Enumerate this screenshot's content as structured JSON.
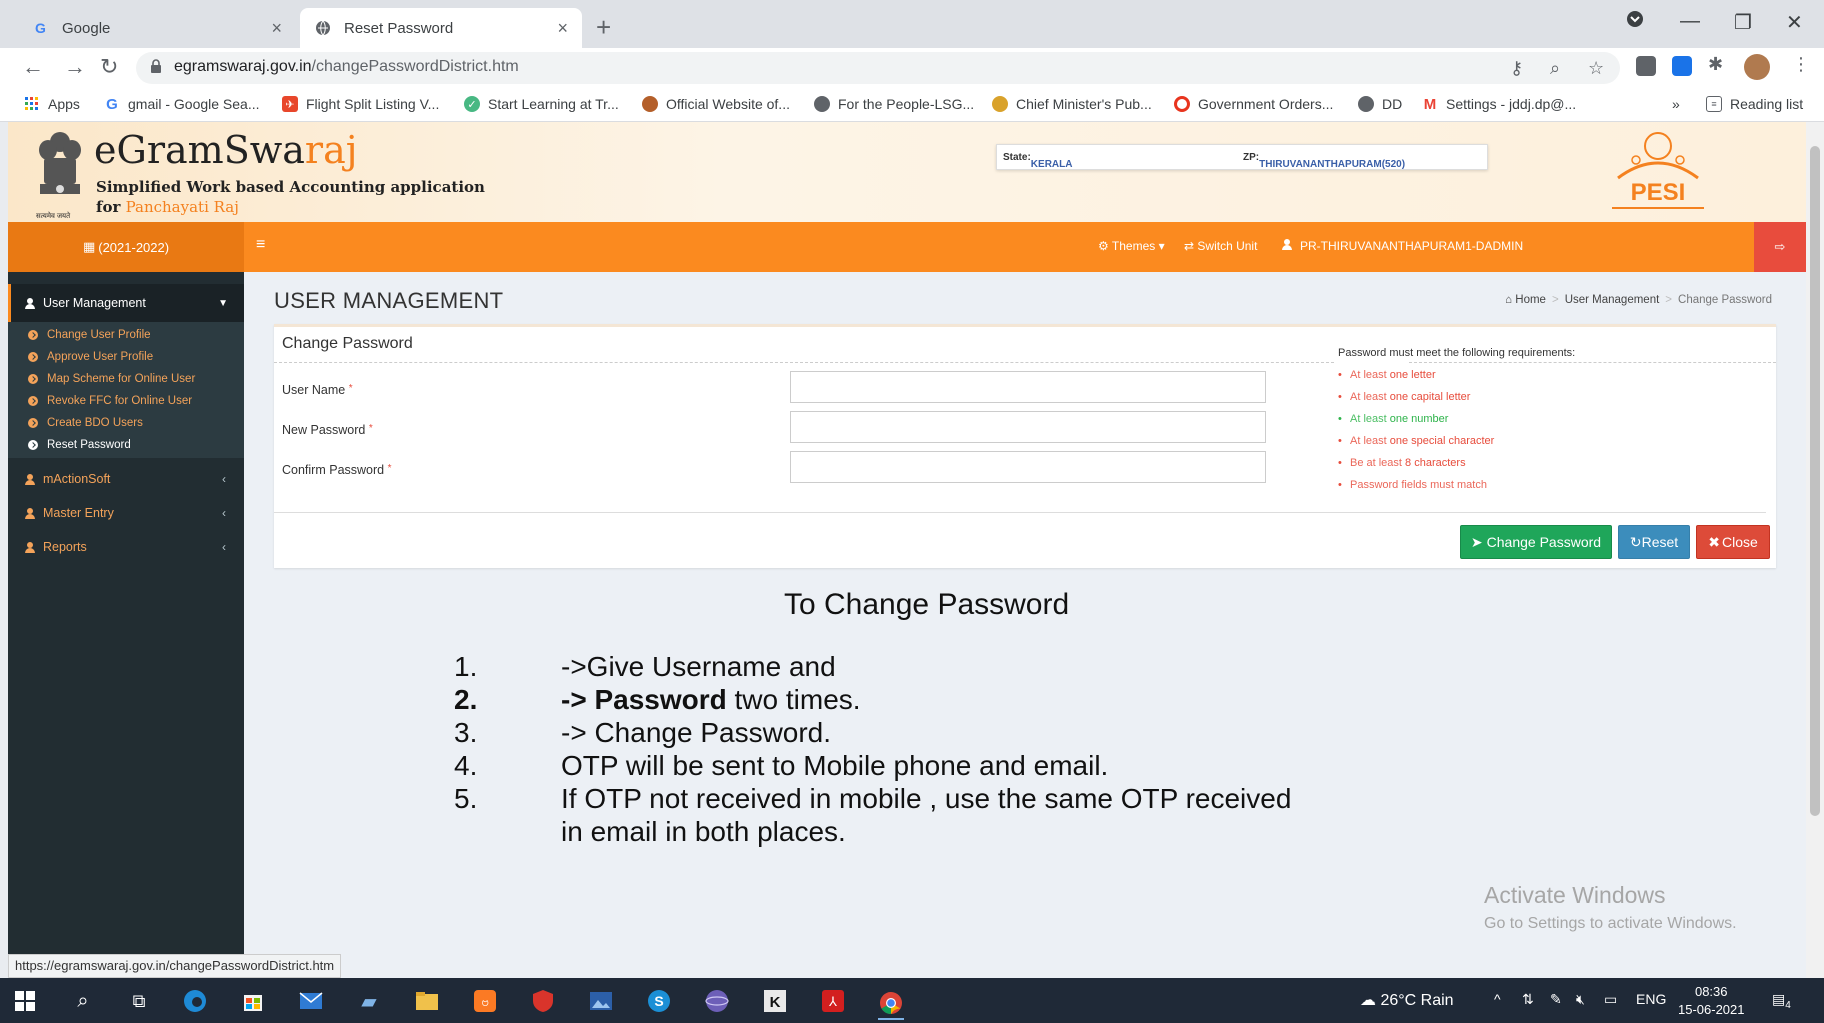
{
  "browser": {
    "tabs": [
      {
        "title": "Google",
        "active": false
      },
      {
        "title": "Reset Password",
        "active": true
      }
    ],
    "url_domain": "egramswaraj.gov.in",
    "url_path": "/changePasswordDistrict.htm",
    "bookmarks": [
      {
        "label": "Apps",
        "icon": "apps-grid-icon"
      },
      {
        "label": "gmail - Google Sea...",
        "icon": "google-icon"
      },
      {
        "label": "Flight Split Listing V...",
        "icon": "flight-icon"
      },
      {
        "label": "Start Learning at Tr...",
        "icon": "learning-icon"
      },
      {
        "label": "Official Website of...",
        "icon": "emblem-icon"
      },
      {
        "label": "For the People-LSG...",
        "icon": "globe-icon"
      },
      {
        "label": "Chief Minister's Pub...",
        "icon": "cm-icon"
      },
      {
        "label": "Government Orders...",
        "icon": "opera-icon"
      },
      {
        "label": "DD",
        "icon": "globe-icon"
      },
      {
        "label": "Settings - jddj.dp@...",
        "icon": "gmail-icon"
      }
    ],
    "bookmarks_overflow": "»",
    "reading_list": "Reading list",
    "status_url": "https://egramswaraj.gov.in/changePasswordDistrict.htm"
  },
  "site": {
    "title_prefix": "eGramSwa",
    "title_suffix": "raj",
    "subtitle": "Simplified Work based Accounting application",
    "subtitle2_prefix": "for ",
    "subtitle2_suffix": "Panchayati Raj",
    "emblem_caption": "सत्यमेव जयते",
    "state_label": "State:",
    "state_value": "KERALA",
    "zp_label": "ZP:",
    "zp_value": "THIRUVANANTHAPURAM(520)",
    "pesi_logo": "PESI"
  },
  "navbar": {
    "year": "(2021-2022)",
    "themes": "Themes",
    "switch_unit": "Switch Unit",
    "user": "PR-THIRUVANANTHAPURAM1-DADMIN"
  },
  "sidebar": {
    "header": "User Management",
    "sub_items": [
      {
        "label": "Change User Profile",
        "active": false
      },
      {
        "label": "Approve User Profile",
        "active": false
      },
      {
        "label": "Map Scheme for Online User",
        "active": false
      },
      {
        "label": "Revoke FFC for Online User",
        "active": false
      },
      {
        "label": "Create BDO Users",
        "active": false
      },
      {
        "label": "Reset Password",
        "active": true
      }
    ],
    "items": [
      {
        "label": "mActionSoft"
      },
      {
        "label": "Master Entry"
      },
      {
        "label": "Reports"
      }
    ]
  },
  "page": {
    "title": "USER MANAGEMENT",
    "breadcrumb": [
      "Home",
      "User Management",
      "Change Password"
    ],
    "box_title": "Change Password",
    "fields": [
      {
        "label": "User Name",
        "value": ""
      },
      {
        "label": "New Password",
        "value": ""
      },
      {
        "label": "Confirm Password",
        "value": ""
      }
    ],
    "requirements_title": "Password must meet the following requirements:",
    "requirements": [
      {
        "pre": "At least ",
        "strong": "one letter",
        "ok": false
      },
      {
        "pre": "At least ",
        "strong": "one capital letter",
        "ok": false
      },
      {
        "pre": "At least ",
        "strong": "one number",
        "ok": true
      },
      {
        "pre": "At least ",
        "strong": "one special character",
        "ok": false
      },
      {
        "pre": "Be at least ",
        "strong": "8 characters",
        "ok": false
      },
      {
        "pre": "Password fields must match",
        "strong": "",
        "ok": false
      }
    ],
    "buttons": {
      "change": "Change Password",
      "reset": "Reset",
      "close": "Close"
    }
  },
  "instructions": {
    "title": "To  Change Password",
    "steps": [
      {
        "num": "1.",
        "pre": "->Give Username and",
        "bold": "",
        "post": ""
      },
      {
        "num": "2.",
        "pre": "",
        "bold": "-> Password",
        "post": " two times."
      },
      {
        "num": "3.",
        "pre": "-> Change Password.",
        "bold": "",
        "post": ""
      },
      {
        "num": "4.",
        "pre": "OTP will be sent to Mobile phone and email.",
        "bold": "",
        "post": ""
      },
      {
        "num": "5.",
        "pre": "If OTP not received in mobile , use the same OTP received",
        "bold": "",
        "post": ""
      },
      {
        "num": "",
        "pre": "in email in both places.",
        "bold": "",
        "post": ""
      }
    ]
  },
  "watermark": {
    "line1": "Activate Windows",
    "line2": "Go to Settings to activate Windows."
  },
  "taskbar": {
    "weather": "26°C  Rain",
    "lang": "ENG",
    "time": "08:36",
    "date": "15-06-2021",
    "notifications": "4"
  },
  "colors": {
    "orange": "#fb8a1f",
    "sidebar_bg": "#222d32",
    "green_btn": "#1fa65a",
    "blue_btn": "#3c8dbc",
    "red_btn": "#dd4b39"
  }
}
